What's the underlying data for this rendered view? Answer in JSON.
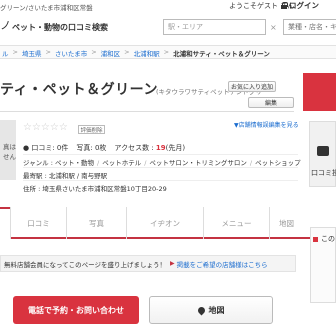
{
  "header": {
    "crumb_top": "グリーン/さいたま市浦和区常盤",
    "welcome": "ようこそゲスト さん",
    "login_label": "ログイン",
    "site_mark": "ノ",
    "site_name": "ペット・動物の口コミ検索",
    "area_placeholder": "駅・エリア",
    "keyword_placeholder": "業種・店名・キ",
    "clear_glyph": "×"
  },
  "breadcrumb": {
    "items": [
      "ル",
      "埼玉県",
      "さいたま市",
      "浦和区",
      "北浦和駅"
    ],
    "sep": ">",
    "current": "北浦和サティ・ペット＆グリーン"
  },
  "shop": {
    "title": "ティ・ペット＆グリーン",
    "kana": "(キタウラワサティペットアンドグリ",
    "favorite_button": "お気に入り追加",
    "report_link": "▼店舗情報誤編集を見る",
    "edit_button": "編集",
    "photo_label": "真は\nせん",
    "stars": "☆☆☆☆☆",
    "rating_badge": "評価削除",
    "stats": {
      "reviews": "● 口コミ: 0件",
      "photos": "写真: 0枚",
      "access_label": "アクセス数 : ",
      "access_value": "19",
      "access_unit": "(先月)"
    },
    "genre_label": "ジャンル : ",
    "genres": [
      "ペット・動物",
      "ペットホテル",
      "ペットサロン・トリミングサロン",
      "ペットショップ"
    ],
    "station_line": "最寄駅 : 北浦和駅 / 南与野駅",
    "address_line": "住所 : 埼玉県さいたま市浦和区常盤10丁目20-29"
  },
  "side": {
    "reviews_label": "口コミ投"
  },
  "tabs": [
    "",
    "口コミ",
    "写真",
    "イヂオン",
    "メニュー",
    "地図"
  ],
  "notice": {
    "text": "無料店舗会員になってこのページを盛り上げましょう！",
    "link": "掲載をご希望の店舗様はこちら",
    "caret": "▶"
  },
  "right_box": {
    "title": "この"
  },
  "buttons": {
    "call": "電話で予約・お問い合わせ",
    "map": "地図"
  },
  "colors": {
    "accent": "#d9333f",
    "link": "#1a6ccf"
  }
}
